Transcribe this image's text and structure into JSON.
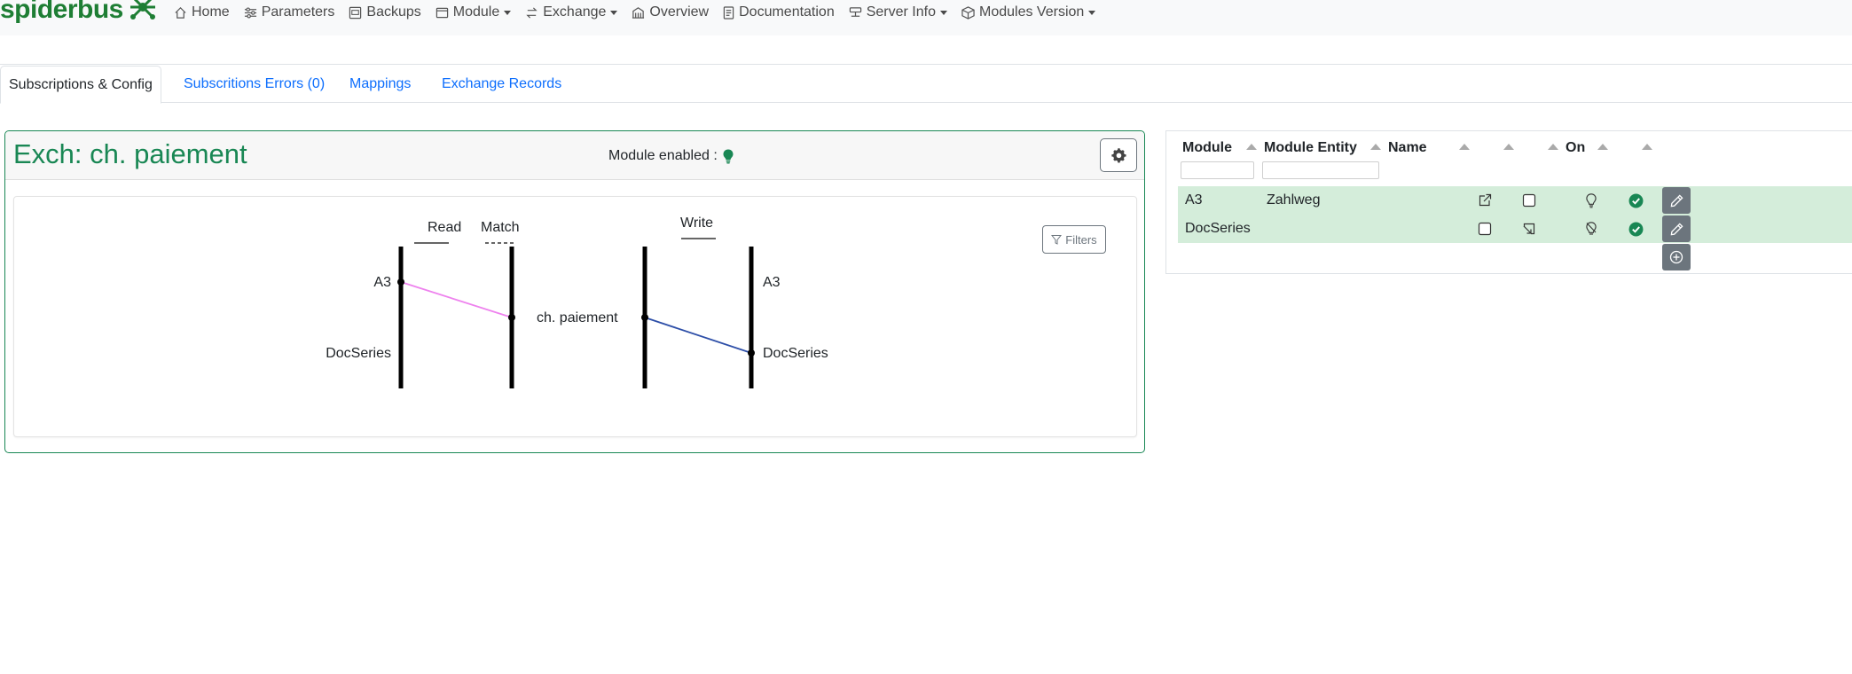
{
  "brand": {
    "first": "spider",
    "second": "bus"
  },
  "nav": [
    {
      "label": "Home",
      "icon": "home-icon"
    },
    {
      "label": "Parameters",
      "icon": "sliders-icon"
    },
    {
      "label": "Backups",
      "icon": "backups-icon"
    },
    {
      "label": "Module",
      "icon": "module-icon",
      "dropdown": true
    },
    {
      "label": "Exchange",
      "icon": "exchange-icon",
      "dropdown": true
    },
    {
      "label": "Overview",
      "icon": "overview-icon"
    },
    {
      "label": "Documentation",
      "icon": "documentation-icon"
    },
    {
      "label": "Server Info",
      "icon": "server-icon",
      "dropdown": true
    },
    {
      "label": "Modules Version",
      "icon": "box-icon",
      "dropdown": true
    }
  ],
  "tabs": [
    {
      "label": "Subscriptions & Config",
      "active": true
    },
    {
      "label": "Subscritions Errors (0)"
    },
    {
      "label": "Mappings"
    },
    {
      "label": "Exchange Records"
    }
  ],
  "card": {
    "title": "Exch: ch. paiement",
    "module_enabled_label": "Module enabled :",
    "filters_label": "Filters"
  },
  "diagram": {
    "read_label": "Read",
    "match_label": "Match",
    "write_label": "Write",
    "read_modules": [
      "A3",
      "DocSeries"
    ],
    "center_label": "ch. paiement",
    "write_modules": [
      "A3",
      "DocSeries"
    ],
    "read_link_color": "#ee82ee",
    "write_link_color": "#2e4fa8"
  },
  "grid": {
    "columns": [
      "Module",
      "Module Entity",
      "Name",
      "On"
    ],
    "rows": [
      {
        "module": "A3",
        "entity": "Zahlweg",
        "name": ""
      },
      {
        "module": "DocSeries",
        "entity": "",
        "name": ""
      }
    ]
  },
  "colors": {
    "brand_green": "#1e7e34",
    "accent_green": "#198754",
    "link_blue": "#0d6efd",
    "row_green": "#d4edda",
    "button_gray": "#6c757d"
  }
}
